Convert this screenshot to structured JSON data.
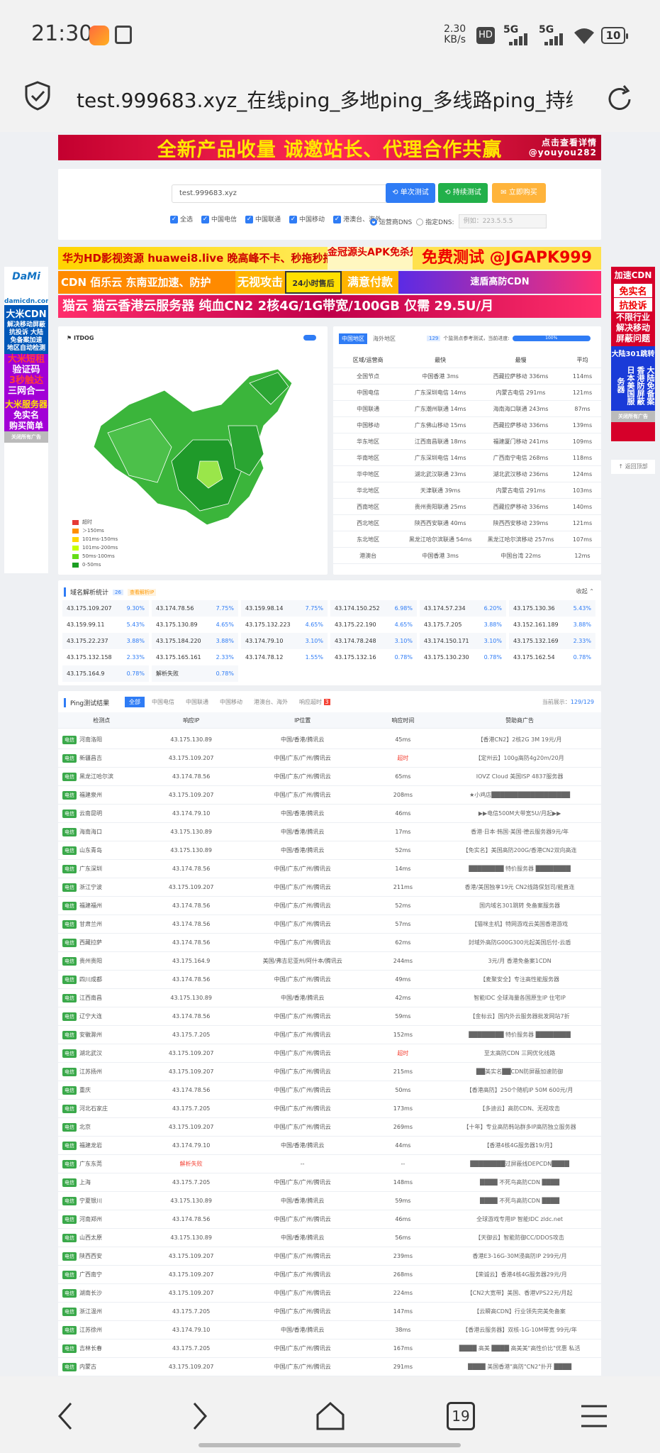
{
  "status_bar": {
    "time": "21:30",
    "net_speed": "2.30",
    "net_unit": "KB/s",
    "hd": "HD",
    "sig1": "5G",
    "sig2": "5G",
    "battery": "10"
  },
  "browser": {
    "url": "test.999683.xyz_在线ping_多地ping_多线路ping_持续",
    "tab_count": "19"
  },
  "banners": {
    "top": "全新产品收量 诚邀站长、代理合作共赢",
    "top_corner": "点击查看详情",
    "top_corner2": "@youyou282",
    "ad1a": "华为HD影视资源 huawei8.live 晚高峰不卡、秒拖秒播",
    "ad1b": "金冠源头APK免杀处理",
    "ad1c": "免费测试 @JGAPK999",
    "ad2a": "CDN 佰乐云 东南亚加速、防护",
    "ad2b": "无视攻击",
    "ad2c": "24小时售后",
    "ad2d": "满意付款",
    "ad2e": "速盾高防CDN",
    "ad3": "猫云 猫云香港云服务器 纯血CN2 2核4G/1G带宽/100GB 仅需 29.5U/月"
  },
  "left_ad": {
    "brand": "DaMi",
    "domain": "damicdn.com",
    "title": "大米CDN",
    "lines": [
      "解决移动屏蔽",
      "抗投诉 大陆",
      "免备案加速",
      "地区自动检测"
    ],
    "promo1": "大米短租",
    "promo2": "验证码",
    "promo3": "3秒触达",
    "promo4": "三网合一",
    "promo5": "大米服务器",
    "promo6": "免实名",
    "promo7": "购买简单",
    "close": "关闭所有广告"
  },
  "right_ad": {
    "title": "加速CDN",
    "l1": "免实名",
    "l2": "抗投诉",
    "l3": "不限行业",
    "l4": "解决移动",
    "l5": "屏蔽问题",
    "l6": "大陆301跳转",
    "cols": "大陆免备案 香港防屏蔽 日本美国服务器",
    "close": "关闭所有广告",
    "back": "返回顶部"
  },
  "search": {
    "value": "test.999683.xyz",
    "btn_single": "单次测试",
    "btn_continuous": "持续测试",
    "btn_open": "立即购买",
    "checks": [
      "全选",
      "中国电信",
      "中国联通",
      "中国移动",
      "港澳台、海外"
    ],
    "dns_label": "运营商DNS",
    "custom_dns": "指定DNS:",
    "dns_placeholder": "例如：223.5.5.5"
  },
  "map": {
    "brand": "ITDOG",
    "legend": [
      "超时",
      "＞150ms",
      "101ms-150ms",
      "101ms-200ms",
      "50ms-100ms",
      "0-50ms"
    ]
  },
  "region": {
    "tabs": [
      "中国地区",
      "海外地区"
    ],
    "nodes": "129",
    "nodes_text": "个监测点参考测试，当前进度:",
    "progress": "100%",
    "headers": [
      "区域/运营商",
      "最快",
      "最慢",
      "平均"
    ],
    "rows": [
      [
        "全国节点",
        "中国香港 3ms",
        "西藏拉萨移动 336ms",
        "114ms"
      ],
      [
        "中国电信",
        "广东深圳电信 14ms",
        "内蒙古电信 291ms",
        "121ms"
      ],
      [
        "中国联通",
        "广东潮州联通 14ms",
        "海南海口联通 243ms",
        "87ms"
      ],
      [
        "中国移动",
        "广东佛山移动 15ms",
        "西藏拉萨移动 336ms",
        "139ms"
      ],
      [
        "华东地区",
        "江西南昌联通 18ms",
        "福建厦门移动 241ms",
        "109ms"
      ],
      [
        "华南地区",
        "广东深圳电信 14ms",
        "广西南宁电信 268ms",
        "118ms"
      ],
      [
        "华中地区",
        "湖北武汉联通 23ms",
        "湖北武汉移动 236ms",
        "124ms"
      ],
      [
        "华北地区",
        "天津联通 39ms",
        "内蒙古电信 291ms",
        "103ms"
      ],
      [
        "西南地区",
        "贵州贵阳联通 25ms",
        "西藏拉萨移动 336ms",
        "140ms"
      ],
      [
        "西北地区",
        "陕西西安联通 40ms",
        "陕西西安移动 239ms",
        "121ms"
      ],
      [
        "东北地区",
        "黑龙江哈尔滨联通 54ms",
        "黑龙江哈尔滨移动 257ms",
        "107ms"
      ],
      [
        "港澳台",
        "中国香港 3ms",
        "中国台湾 22ms",
        "12ms"
      ]
    ]
  },
  "dns_stats": {
    "title": "域名解析统计",
    "count": "26",
    "tag": "查看解析IP",
    "collapse": "收起",
    "items": [
      [
        "43.175.109.207",
        "9.30%"
      ],
      [
        "43.174.78.56",
        "7.75%"
      ],
      [
        "43.159.98.14",
        "7.75%"
      ],
      [
        "43.174.150.252",
        "6.98%"
      ],
      [
        "43.174.57.234",
        "6.20%"
      ],
      [
        "43.175.130.36",
        "5.43%"
      ],
      [
        "43.159.99.11",
        "5.43%"
      ],
      [
        "43.175.130.89",
        "4.65%"
      ],
      [
        "43.175.132.223",
        "4.65%"
      ],
      [
        "43.175.22.190",
        "4.65%"
      ],
      [
        "43.175.7.205",
        "3.88%"
      ],
      [
        "43.152.161.189",
        "3.88%"
      ],
      [
        "43.175.22.237",
        "3.88%"
      ],
      [
        "43.175.184.220",
        "3.88%"
      ],
      [
        "43.174.79.10",
        "3.10%"
      ],
      [
        "43.174.78.248",
        "3.10%"
      ],
      [
        "43.174.150.171",
        "3.10%"
      ],
      [
        "43.175.132.169",
        "2.33%"
      ],
      [
        "43.175.132.158",
        "2.33%"
      ],
      [
        "43.175.165.161",
        "2.33%"
      ],
      [
        "43.174.78.12",
        "1.55%"
      ],
      [
        "43.175.132.16",
        "0.78%"
      ],
      [
        "43.175.130.230",
        "0.78%"
      ],
      [
        "43.175.162.54",
        "0.78%"
      ],
      [
        "43.175.164.9",
        "0.78%"
      ],
      [
        "解析失败",
        "0.78%"
      ]
    ]
  },
  "ping": {
    "title": "Ping测试结果",
    "filters": [
      "全部",
      "中国电信",
      "中国联通",
      "中国移动",
      "港澳台、海外",
      "响应超时"
    ],
    "timeout_count": "3",
    "shown_label": "当前展示：",
    "shown": "129/129",
    "headers": [
      "检测点",
      "响应IP",
      "IP位置",
      "响应时间",
      "赞助商广告"
    ],
    "rows": [
      [
        "电信",
        "河南洛阳",
        "43.175.130.89",
        "中国/香港/腾讯云",
        "45ms",
        "【香港CN2】2核2G 3M 19元/月"
      ],
      [
        "电信",
        "新疆昌吉",
        "43.175.109.207",
        "中国/广东/广州/腾讯云",
        "超时",
        "【定州云】100g高防4g20m/20月"
      ],
      [
        "电信",
        "黑龙江哈尔滨",
        "43.174.78.56",
        "中国/广东/广州/腾讯云",
        "65ms",
        "IOVZ Cloud 美国ISP 4837服务器"
      ],
      [
        "电信",
        "福建泉州",
        "43.175.109.207",
        "中国/广东/广州/腾讯云",
        "208ms",
        "★小鸡店██████████████████"
      ],
      [
        "电信",
        "云南昆明",
        "43.174.79.10",
        "中国/香港/腾讯云",
        "46ms",
        "▶▶电信500M大带宽5U/月起▶▶"
      ],
      [
        "电信",
        "海南海口",
        "43.175.130.89",
        "中国/香港/腾讯云",
        "17ms",
        "香港·日本·韩国·美国·德云服务器9元/年"
      ],
      [
        "电信",
        "山东青岛",
        "43.175.130.89",
        "中国/香港/腾讯云",
        "52ms",
        "【免实名】美国高防200G/香港CN2双向高连"
      ],
      [
        "电信",
        "广东深圳",
        "43.174.78.56",
        "中国/广东/广州/腾讯云",
        "14ms",
        "████████ 特价服务器 ████████"
      ],
      [
        "电信",
        "浙江宁波",
        "43.175.109.207",
        "中国/广东/广州/腾讯云",
        "211ms",
        "香港/美国独享19元 CN2线路保划司/能直连"
      ],
      [
        "电信",
        "福建福州",
        "43.174.78.56",
        "中国/广东/广州/腾讯云",
        "52ms",
        "国内域名301跳转 免备案服务器"
      ],
      [
        "电信",
        "甘肃兰州",
        "43.174.78.56",
        "中国/广东/广州/腾讯云",
        "57ms",
        "【猫咪主机】特网游戏云美国香港游戏"
      ],
      [
        "电信",
        "西藏拉萨",
        "43.174.78.56",
        "中国/广东/广州/腾讯云",
        "62ms",
        "封域外高防G00G300元起美国后付-云盾"
      ],
      [
        "电信",
        "贵州贵阳",
        "43.175.164.9",
        "美国/弗吉尼亚州/阿什本/腾讯云",
        "244ms",
        "3元/月 香港免备案1CDN"
      ],
      [
        "电信",
        "四川成都",
        "43.174.78.56",
        "中国/广东/广州/腾讯云",
        "49ms",
        "【麦聚安全】专注高性能服务器"
      ],
      [
        "电信",
        "江西南昌",
        "43.175.130.89",
        "中国/香港/腾讯云",
        "42ms",
        "智能IDC 全球海量各国原生IP 住宅IP"
      ],
      [
        "电信",
        "辽宁大连",
        "43.174.78.56",
        "中国/广东/广州/腾讯云",
        "59ms",
        "【金标云】国内外云服务器批发网站7折"
      ],
      [
        "电信",
        "安徽滁州",
        "43.175.7.205",
        "中国/广东/广州/腾讯云",
        "152ms",
        "████████ 特价服务器 ████████"
      ],
      [
        "电信",
        "湖北武汉",
        "43.175.109.207",
        "中国/广东/广州/腾讯云",
        "超时",
        "至太高防CDN 三网优化线路"
      ],
      [
        "电信",
        "江苏扬州",
        "43.175.109.207",
        "中国/广东/广州/腾讯云",
        "215ms",
        "██美实名██CDN防屏蔽加速防御"
      ],
      [
        "电信",
        "重庆",
        "43.174.78.56",
        "中国/广东/广州/腾讯云",
        "50ms",
        "【香港高防】250个随机IP 50M 600元/月"
      ],
      [
        "电信",
        "河北石家庄",
        "43.175.7.205",
        "中国/广东/广州/腾讯云",
        "173ms",
        "【多迪云】高防CDN、无视攻击"
      ],
      [
        "电信",
        "北京",
        "43.175.109.207",
        "中国/广东/广州/腾讯云",
        "269ms",
        "【十年】专业高防韩站群多IP高防独立服务器"
      ],
      [
        "电信",
        "福建龙岩",
        "43.174.79.10",
        "中国/香港/腾讯云",
        "44ms",
        "【香港4核4G服务器19/月】"
      ],
      [
        "电信",
        "广东东莞",
        "解析失败",
        "--",
        "--",
        "████████过屏蔽线DEPCDN████"
      ],
      [
        "电信",
        "上海",
        "43.175.7.205",
        "中国/广东/广州/腾讯云",
        "148ms",
        "████ 不死鸟高防CDN ████"
      ],
      [
        "电信",
        "宁夏银川",
        "43.175.130.89",
        "中国/香港/腾讯云",
        "59ms",
        "████ 不死鸟高防CDN ████"
      ],
      [
        "电信",
        "河南郑州",
        "43.174.78.56",
        "中国/广东/广州/腾讯云",
        "46ms",
        "全球游戏专用IP 智能IDC zldc.net"
      ],
      [
        "电信",
        "山西太原",
        "43.175.130.89",
        "中国/香港/腾讯云",
        "56ms",
        "【天御云】智能防御CC/DDOS攻击"
      ],
      [
        "电信",
        "陕西西安",
        "43.175.109.207",
        "中国/广东/广州/腾讯云",
        "239ms",
        "香港E3-16G-30M浸高防IP 299元/月"
      ],
      [
        "电信",
        "广西南宁",
        "43.175.109.207",
        "中国/广东/广州/腾讯云",
        "268ms",
        "【荣诚云】香港4核4G服务器29元/月"
      ],
      [
        "电信",
        "湖南长沙",
        "43.175.109.207",
        "中国/广东/广州/腾讯云",
        "224ms",
        "【CN2大宽带】美国、香港VPS22元/月起"
      ],
      [
        "电信",
        "浙江温州",
        "43.175.7.205",
        "中国/广东/广州/腾讯云",
        "147ms",
        "【云瞬高CDN】行业领先完美免备案"
      ],
      [
        "电信",
        "江苏徐州",
        "43.174.79.10",
        "中国/香港/腾讯云",
        "38ms",
        "【香港云服务器】双核-1G-10M带宽 99元/年"
      ],
      [
        "电信",
        "吉林长春",
        "43.175.7.205",
        "中国/广东/广州/腾讯云",
        "167ms",
        "████ 高美 ████ 高美美\"高性价比\"优惠  私活"
      ],
      [
        "电信",
        "内蒙古",
        "43.175.109.207",
        "中国/广东/广州/腾讯云",
        "291ms",
        "████ 美国香港\"高防\"CN2\"扑开 ████"
      ]
    ]
  }
}
